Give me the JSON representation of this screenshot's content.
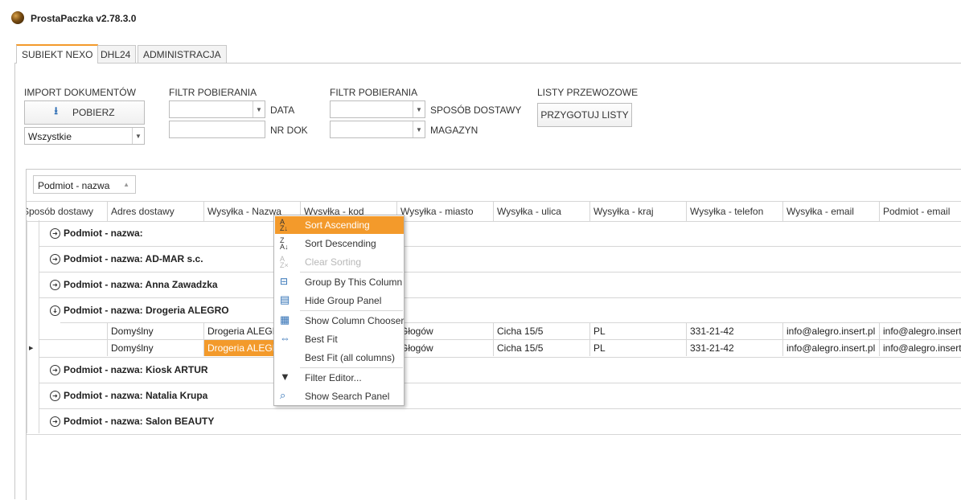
{
  "app": {
    "title": "ProstaPaczka v2.78.3.0"
  },
  "tabs": [
    {
      "label": "SUBIEKT NEXO"
    },
    {
      "label": "DHL24"
    },
    {
      "label": "ADMINISTRACJA"
    }
  ],
  "toolbar": {
    "import_label": "IMPORT DOKUMENTÓW",
    "pobierz_label": "POBIERZ",
    "import_combo_value": "Wszystkie",
    "filtr1_label": "FILTR POBIERANIA",
    "data_label": "DATA",
    "nrdok_label": "NR DOK",
    "filtr2_label": "FILTR POBIERANIA",
    "sposob_label": "SPOSÓB DOSTAWY",
    "magazyn_label": "MAGAZYN",
    "listy_label": "LISTY PRZEWOZOWE",
    "przygotuj_label": "PRZYGOTUJ LISTY"
  },
  "grid": {
    "group_chip": "Podmiot - nazwa",
    "columns": [
      "Sposób dostawy",
      "Adres dostawy",
      "Wysyłka - Nazwa",
      "Wysyłka - kod",
      "Wysyłka - miasto",
      "Wysyłka - ulica",
      "Wysyłka - kraj",
      "Wysyłka - telefon",
      "Wysyłka - email",
      "Podmiot - email"
    ],
    "groups": [
      {
        "label": "Podmiot - nazwa:"
      },
      {
        "label": "Podmiot - nazwa: AD-MAR s.c."
      },
      {
        "label": "Podmiot - nazwa: Anna Zawadzka"
      },
      {
        "label": "Podmiot - nazwa: Drogeria ALEGRO"
      },
      {
        "label": "Podmiot - nazwa: Kiosk ARTUR"
      },
      {
        "label": "Podmiot - nazwa: Natalia Krupa"
      },
      {
        "label": "Podmiot - nazwa: Salon BEAUTY"
      }
    ],
    "rows": [
      [
        "Domyślny",
        "Drogeria ALEGRO",
        "",
        "Głogów",
        "Cicha  15/5",
        "PL",
        "331-21-42",
        "info@alegro.insert.pl",
        "info@alegro.insert.pl"
      ],
      [
        "Domyślny",
        "Drogeria ALEGRO",
        "",
        "Głogów",
        "Cicha  15/5",
        "PL",
        "331-21-42",
        "info@alegro.insert.pl",
        "info@alegro.insert.pl"
      ]
    ]
  },
  "context_menu": {
    "items": [
      {
        "label": "Sort Ascending",
        "icon": "sort-ascending-icon"
      },
      {
        "label": "Sort Descending",
        "icon": "sort-descending-icon"
      },
      {
        "label": "Clear Sorting",
        "icon": "clear-sorting-icon"
      },
      {
        "label": "Group By This Column",
        "icon": "group-by-icon"
      },
      {
        "label": "Hide Group Panel",
        "icon": "group-panel-icon"
      },
      {
        "label": "Show Column Chooser",
        "icon": "column-chooser-icon"
      },
      {
        "label": "Best Fit",
        "icon": "best-fit-icon"
      },
      {
        "label": "Best Fit (all columns)",
        "icon": ""
      },
      {
        "label": "Filter Editor...",
        "icon": "filter-icon"
      },
      {
        "label": "Show Search Panel",
        "icon": "search-icon"
      }
    ]
  },
  "colors": {
    "accent": "#f39a2b",
    "border": "#c8c8c8"
  }
}
